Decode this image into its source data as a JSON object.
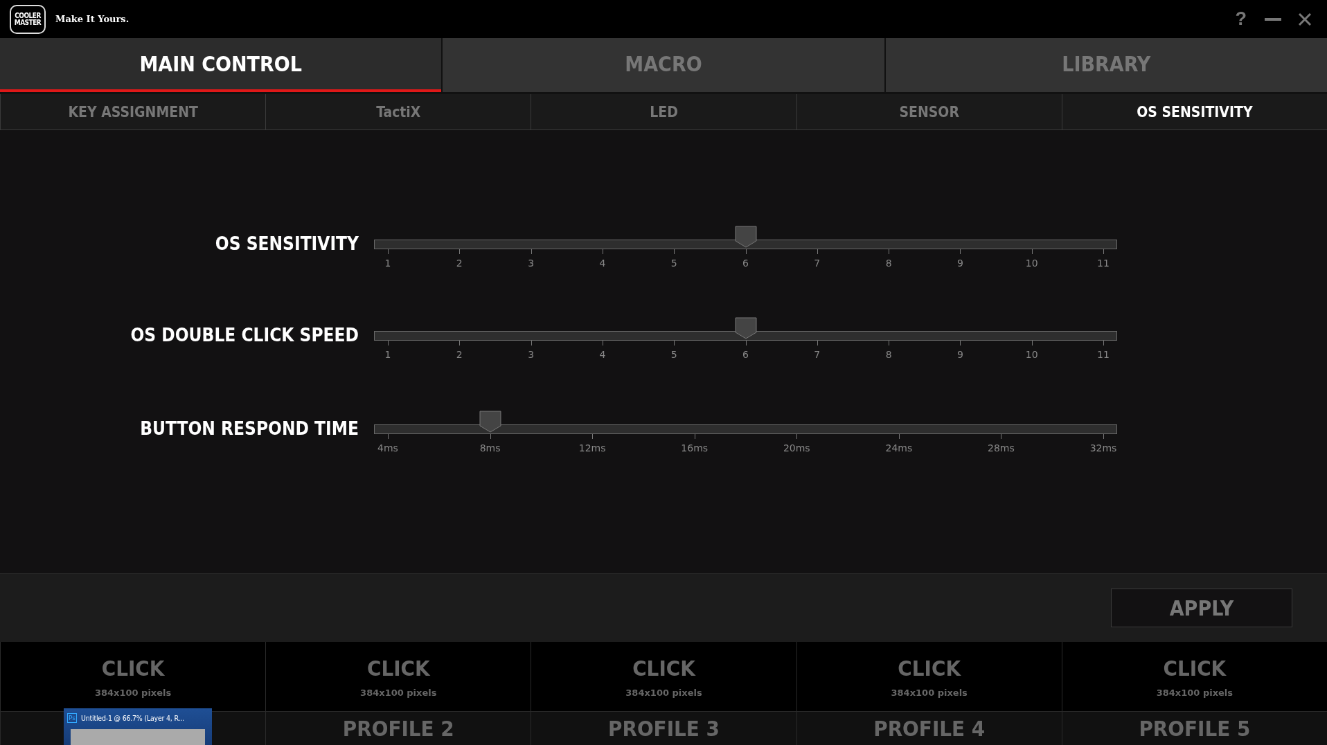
{
  "window": {
    "logo": [
      "COOLER",
      "MASTER"
    ],
    "tagline": "Make It Yours.",
    "help": "?"
  },
  "main_tabs": [
    {
      "label": "MAIN CONTROL",
      "selected": true
    },
    {
      "label": "MACRO",
      "selected": false
    },
    {
      "label": "LIBRARY",
      "selected": false
    }
  ],
  "sub_tabs": [
    {
      "label": "KEY ASSIGNMENT",
      "selected": false
    },
    {
      "label": "TactiX",
      "selected": false
    },
    {
      "label": "LED",
      "selected": false
    },
    {
      "label": "SENSOR",
      "selected": false
    },
    {
      "label": "OS SENSITIVITY",
      "selected": true
    }
  ],
  "sliders": [
    {
      "label": "OS SENSITIVITY",
      "level": 0.5,
      "ticks": [
        "1",
        "2",
        "3",
        "4",
        "5",
        "6",
        "7",
        "8",
        "9",
        "10",
        "11"
      ]
    },
    {
      "label": "OS DOUBLE CLICK SPEED",
      "level": 0.5,
      "ticks": [
        "1",
        "2",
        "3",
        "4",
        "5",
        "6",
        "7",
        "8",
        "9",
        "10",
        "11"
      ]
    },
    {
      "label": "BUTTON RESPOND TIME",
      "level": 0.143,
      "ticks": [
        "4ms",
        "8ms",
        "12ms",
        "16ms",
        "20ms",
        "24ms",
        "28ms",
        "32ms"
      ]
    }
  ],
  "apply_button": "APPLY",
  "profiles": [
    {
      "title": "CLICK",
      "size": "384x100 pixels"
    },
    {
      "title": "CLICK",
      "size": "384x100 pixels",
      "name": "PROFILE 2"
    },
    {
      "title": "CLICK",
      "size": "384x100 pixels",
      "name": "PROFILE 3"
    },
    {
      "title": "CLICK",
      "size": "384x100 pixels",
      "name": "PROFILE 4"
    },
    {
      "title": "CLICK",
      "size": "384x100 pixels",
      "name": "PROFILE 5"
    }
  ],
  "taskbar_preview": {
    "app_badge": "Ps",
    "title": "Untitled-1 @ 66.7% (Layer 4, R..."
  }
}
